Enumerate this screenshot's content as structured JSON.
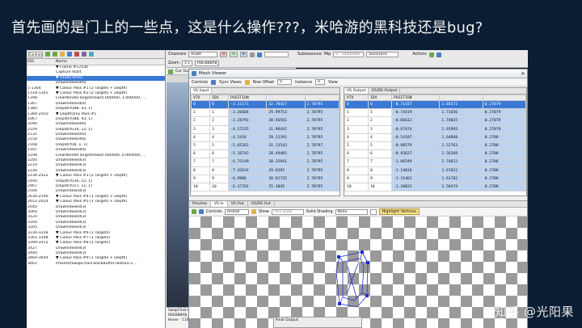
{
  "slide": {
    "title": "首先画的是门上的一些点，这是什么操作???，米哈游的黑科技还是bug?",
    "watermark": "知乎 @光阳果"
  },
  "left_panel": {
    "controls_label": "Controls",
    "col_eid": "EID",
    "col_name": "Name",
    "events": [
      {
        "eid": "",
        "name": "▼ Frame #17030",
        "sel": false
      },
      {
        "eid": "",
        "name": "    Capture Start",
        "sel": false
      },
      {
        "eid": "",
        "name": "    ▼ Draw(3456)",
        "sel": true
      },
      {
        "eid": "",
        "name": "        DrawIndexed(6)",
        "sel": false
      },
      {
        "eid": "1-1304",
        "name": "▼ Colour Pass #1 (2 Targets + Depth)",
        "sel": false
      },
      {
        "eid": "1318-1345",
        "name": "▼ Colour Pass #2 (2 Targets + Depth)",
        "sel": false
      },
      {
        "eid": "1348",
        "name": "    ClearRenderTargetView(0.000000, 1.000000, ...",
        "sel": false
      },
      {
        "eid": "1367",
        "name": "    DrawIndexed(6)",
        "sel": false
      },
      {
        "eid": "1380",
        "name": "    Dispatch(88, 43, 1)",
        "sel": false
      },
      {
        "eid": "1384-2050",
        "name": "▼ DepthOnly Pass #1",
        "sel": false
      },
      {
        "eid": "2067",
        "name": "    Dispatch(88, 43, 1)",
        "sel": false
      },
      {
        "eid": "2090",
        "name": "    DrawIndexed(6)",
        "sel": false
      },
      {
        "eid": "2109",
        "name": "    Dispatch(34, 22, 1)",
        "sel": false
      },
      {
        "eid": "2131",
        "name": "    DrawIndexed(6)",
        "sel": false
      },
      {
        "eid": "2150",
        "name": "    DrawIndexed(6)",
        "sel": false
      },
      {
        "eid": "2168",
        "name": "    Dispatch(8, 1, 1)",
        "sel": false
      },
      {
        "eid": "2187",
        "name": "    DrawIndexed(6)",
        "sel": false
      },
      {
        "eid": "2198",
        "name": "    ClearRenderTargetView(0.000000, 0.000000, ...",
        "sel": false
      },
      {
        "eid": "2200",
        "name": "    DrawIndexed(3)",
        "sel": false
      },
      {
        "eid": "2210",
        "name": "    DrawIndexed(3)",
        "sel": false
      },
      {
        "eid": "2230",
        "name": "    DrawIndexed(3)",
        "sel": false
      },
      {
        "eid": "2236-2422",
        "name": "▼ Colour Pass #3 (2 Targets + Depth)",
        "sel": false
      },
      {
        "eid": "2440",
        "name": "    Dispatch(34, 22, 1)",
        "sel": false
      },
      {
        "eid": "2467",
        "name": "    Dispatch(17, 11, 1)",
        "sel": false
      },
      {
        "eid": "2506",
        "name": "    DrawIndexed(3)",
        "sel": false
      },
      {
        "eid": "2630-2590",
        "name": "▼ Colour Pass #4 (1 Targets + Depth)",
        "sel": false
      },
      {
        "eid": "2612-2624",
        "name": "▼ Colour Pass #5 (1 Targets + Depth)",
        "sel": false
      },
      {
        "eid": "2640",
        "name": "    DrawIndexed(3)",
        "sel": false
      },
      {
        "eid": "3060",
        "name": "    DrawIndexed(3)",
        "sel": false
      },
      {
        "eid": "3120",
        "name": "    DrawIndexed(3)",
        "sel": false
      },
      {
        "eid": "3160",
        "name": "    DrawIndexed(3)",
        "sel": false
      },
      {
        "eid": "3205",
        "name": "    DrawIndexed(3)",
        "sel": false
      },
      {
        "eid": "3230-3358",
        "name": "▼ Colour Pass #6 (1 Targets)",
        "sel": false
      },
      {
        "eid": "3361-3398",
        "name": "▼ Colour Pass #7 (1 Targets)",
        "sel": false
      },
      {
        "eid": "3399-3412",
        "name": "▼ Colour Pass #8 (1 Targets)",
        "sel": false
      },
      {
        "eid": "3427",
        "name": "    DrawIndexed(3)",
        "sel": false
      },
      {
        "eid": "3440",
        "name": "    DrawIndexed(3)",
        "sel": false
      },
      {
        "eid": "3460-3644",
        "name": "▼ Colour Pass #9 (1 Targets + Depth)",
        "sel": false
      },
      {
        "eid": "3665",
        "name": "    Present(SwapChain-BackBuffer-Texture-1...",
        "sel": false
      }
    ]
  },
  "top_toolbar": {
    "channels_label": "Channels",
    "channels_value": "RGBA",
    "channel_r": "R",
    "channel_g": "G",
    "channel_b": "B",
    "subresource_label": "Subresource",
    "mip_label": "Mip",
    "mip_value": "0 - 1440x900",
    "slice_label": "Slice/Face",
    "actions_label": "Actions",
    "zoom_label": "Zoom",
    "zoom_value": "1:1",
    "format_value": "R8G8B8A8_SRGB"
  },
  "texture_panel": {
    "tab": "Cur Output 0",
    "status_lines": [
      "SwapChain-BackBuffer-Texture-1440x900 1 mips - 1 arr",
      "R8G8B8A8_SRGB Viewed as UNORM",
      "Hover - 1107 - 5 (144,900) ..."
    ]
  },
  "mesh_viewer": {
    "title": "Mesh Viewer",
    "controls_label": "Controls",
    "sync_views": "Sync Views",
    "row_offset_label": "Row Offset",
    "row_offset_value": "0",
    "instance_label": "Instance",
    "instance_value": "0",
    "view_label": "View",
    "vs_input": {
      "tabs": [
        "VS Input"
      ],
      "headers": [
        "VTX",
        "IDX",
        "POSITION",
        "",
        ""
      ],
      "rows": [
        [
          "0",
          "0",
          "-3.31171",
          "32.70427",
          "2.70795"
        ],
        [
          "1",
          "1",
          "-3.26684",
          "29.99753",
          "2.70795"
        ],
        [
          "2",
          "2",
          "-2.28791",
          "30.56561",
          "2.70795"
        ],
        [
          "3",
          "3",
          "-4.57235",
          "31.96442",
          "2.70795"
        ],
        [
          "4",
          "4",
          "-4.2434",
          "29.31391",
          "2.70795"
        ],
        [
          "5",
          "5",
          "-5.65261",
          "31.13543",
          "2.70797"
        ],
        [
          "6",
          "6",
          "-5.16742",
          "28.49405",
          "2.70795"
        ],
        [
          "7",
          "7",
          "-6.75149",
          "30.25941",
          "2.70795"
        ],
        [
          "8",
          "8",
          "-7.42634",
          "29.0393",
          "2.70795"
        ],
        [
          "9",
          "9",
          "-6.9906",
          "28.02735",
          "2.70795"
        ],
        [
          "10",
          "10",
          "-6.37781",
          "25.3045",
          "2.70795"
        ]
      ]
    },
    "vs_output": {
      "tabs": [
        "VS Output",
        "GS/DS Output"
      ],
      "headers": [
        "VTX",
        "IDX",
        "POSITION",
        "",
        ""
      ],
      "rows": [
        [
          "0",
          "0",
          "-0.71437",
          "1.85472",
          "0.27079"
        ],
        [
          "1",
          "1",
          "-0.74419",
          "1.71656",
          "0.27079"
        ],
        [
          "2",
          "2",
          "-0.66612",
          "1.74825",
          "0.27079"
        ],
        [
          "3",
          "3",
          "-0.67474",
          "1.91993",
          "0.27079"
        ],
        [
          "4",
          "4",
          "-0.54187",
          "1.64868",
          "0.2708"
        ],
        [
          "5",
          "5",
          "-0.88579",
          "1.52763",
          "0.2708"
        ],
        [
          "6",
          "6",
          "-0.93627",
          "1.56369",
          "0.2708"
        ],
        [
          "7",
          "7",
          "-1.09249",
          "1.74613",
          "0.2708"
        ],
        [
          "8",
          "8",
          "-1.14016",
          "1.67822",
          "0.2708"
        ],
        [
          "9",
          "9",
          "-1.11462",
          "1.61702",
          "0.2708"
        ],
        [
          "10",
          "10",
          "-1.10832",
          "1.56474",
          "0.2708"
        ]
      ]
    },
    "preview": {
      "label": "Preview",
      "tabs": [
        "VS In",
        "VS Out",
        "GS/DS Out"
      ],
      "controls_label": "Controls",
      "camera_value": "Arcball",
      "show_label": "Show",
      "show_value": "This Draw",
      "shading_label": "Solid Shading",
      "shading_value": "None",
      "wireframe_label": "Wireframe",
      "highlight_label": "Highlight Vertices"
    },
    "final_output": "Final Output"
  }
}
